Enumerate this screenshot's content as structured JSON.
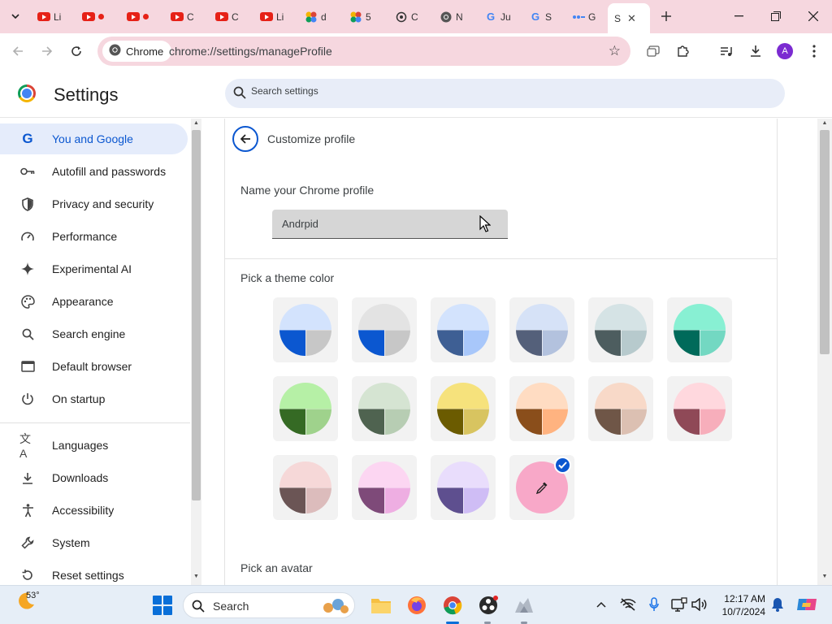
{
  "browser": {
    "tabs": [
      {
        "label": "Li",
        "favicon": "youtube-icon"
      },
      {
        "label": "",
        "favicon": "youtube-icon"
      },
      {
        "label": "",
        "favicon": "youtube-icon"
      },
      {
        "label": "C",
        "favicon": "youtube-icon"
      },
      {
        "label": "C",
        "favicon": "youtube-icon"
      },
      {
        "label": "Li",
        "favicon": "youtube-icon"
      },
      {
        "label": "d",
        "favicon": "pinwheel-icon"
      },
      {
        "label": "5",
        "favicon": "pinwheel-icon"
      },
      {
        "label": "C",
        "favicon": "chatgpt-icon"
      },
      {
        "label": "N",
        "favicon": "chrome-icon"
      },
      {
        "label": "Ju",
        "favicon": "google-icon"
      },
      {
        "label": "S",
        "favicon": "google-icon"
      },
      {
        "label": "G",
        "favicon": "password-icon"
      },
      {
        "label": "S",
        "favicon": "settings-icon",
        "active": true
      }
    ],
    "omnibox": {
      "chip_label": "Chrome",
      "url": "chrome://settings/manageProfile"
    },
    "profile_initial": "A"
  },
  "settings": {
    "title": "Settings",
    "search_placeholder": "Search settings",
    "nav": [
      {
        "label": "You and Google",
        "icon": "google-g-icon",
        "active": true
      },
      {
        "label": "Autofill and passwords",
        "icon": "key-icon"
      },
      {
        "label": "Privacy and security",
        "icon": "shield-icon"
      },
      {
        "label": "Performance",
        "icon": "speedometer-icon"
      },
      {
        "label": "Experimental AI",
        "icon": "sparkle-icon"
      },
      {
        "label": "Appearance",
        "icon": "palette-icon"
      },
      {
        "label": "Search engine",
        "icon": "search-icon"
      },
      {
        "label": "Default browser",
        "icon": "browser-window-icon"
      },
      {
        "label": "On startup",
        "icon": "power-icon"
      },
      {
        "label": "Languages",
        "icon": "translate-icon"
      },
      {
        "label": "Downloads",
        "icon": "download-icon"
      },
      {
        "label": "Accessibility",
        "icon": "accessibility-icon"
      },
      {
        "label": "System",
        "icon": "wrench-icon"
      },
      {
        "label": "Reset settings",
        "icon": "reset-icon"
      }
    ]
  },
  "profile": {
    "page_title": "Customize profile",
    "name_label": "Name your Chrome profile",
    "name_value": "Andrpid",
    "theme_label": "Pick a theme color",
    "avatar_label": "Pick an avatar",
    "themes": [
      {
        "top": "#d3e3fd",
        "bl": "#0b57d0",
        "br": "#c7c7c7"
      },
      {
        "top": "#e3e3e3",
        "bl": "#0b57d0",
        "br": "#c7c7c7"
      },
      {
        "top": "#d3e3fd",
        "bl": "#3e5f94",
        "br": "#a8c7fa"
      },
      {
        "top": "#d6e2f7",
        "bl": "#54607a",
        "br": "#b3c2de"
      },
      {
        "top": "#d5e3e5",
        "bl": "#4d5d5f",
        "br": "#b7cacd"
      },
      {
        "top": "#88f0d3",
        "bl": "#006a5a",
        "br": "#73d8c2"
      },
      {
        "top": "#b6f0a6",
        "bl": "#356a24",
        "br": "#9fd28c"
      },
      {
        "top": "#d5e4d2",
        "bl": "#4f6350",
        "br": "#b7cdb3"
      },
      {
        "top": "#f6e27c",
        "bl": "#6b5b00",
        "br": "#d8c460"
      },
      {
        "top": "#ffdcc2",
        "bl": "#8a4e1b",
        "br": "#ffb380"
      },
      {
        "top": "#f8d9c8",
        "bl": "#6f5647",
        "br": "#dcc0b2"
      },
      {
        "top": "#ffd8de",
        "bl": "#8f4957",
        "br": "#f7aebb"
      },
      {
        "top": "#f6d8d8",
        "bl": "#6b5555",
        "br": "#dcbcbc"
      },
      {
        "top": "#fcd6f2",
        "bl": "#7e4a79",
        "br": "#eeaee2"
      },
      {
        "top": "#e9ddfc",
        "bl": "#5e4f8f",
        "br": "#cfbdf5"
      }
    ],
    "custom_theme": {
      "color": "#f8a8c8",
      "icon": "eyedropper-icon",
      "selected": true
    }
  },
  "taskbar": {
    "weather_temp": "53°",
    "search_label": "Search",
    "apps": [
      "file-explorer-icon",
      "firefox-icon",
      "chrome-icon",
      "obs-icon",
      "fox-app-icon"
    ],
    "tray": [
      "chevron-up-icon",
      "network-off-icon",
      "microphone-icon",
      "display-icon",
      "volume-icon"
    ],
    "time": "12:17 AM",
    "date": "10/7/2024"
  }
}
